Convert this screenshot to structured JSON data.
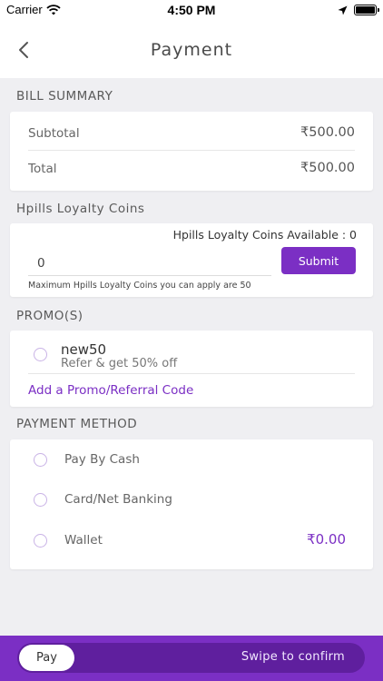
{
  "status_bar": {
    "carrier": "Carrier",
    "time": "4:50 PM"
  },
  "header": {
    "title": "Payment"
  },
  "bill_summary": {
    "heading": "BILL SUMMARY",
    "rows": [
      {
        "label": "Subtotal",
        "value": "₹500.00"
      },
      {
        "label": "Total",
        "value": "₹500.00"
      }
    ]
  },
  "loyalty": {
    "heading": "Hpills Loyalty Coins",
    "available_text": "Hpills Loyalty Coins Available : 0",
    "input_value": "0",
    "submit_label": "Submit",
    "note": "Maximum Hpills Loyalty Coins you can apply are 50"
  },
  "promos": {
    "heading": "PROMO(S)",
    "items": [
      {
        "code": "new50",
        "description": "Refer & get 50% off"
      }
    ],
    "add_link": "Add a Promo/Referral Code"
  },
  "payment_method": {
    "heading": "PAYMENT METHOD",
    "options": [
      {
        "label": "Pay By Cash",
        "amount": ""
      },
      {
        "label": "Card/Net Banking",
        "amount": ""
      },
      {
        "label": "Wallet",
        "amount": "₹0.00"
      }
    ]
  },
  "swipe": {
    "knob_label": "Pay",
    "hint": "Swipe to confirm"
  },
  "colors": {
    "accent": "#7b2fc4",
    "background": "#efeff2",
    "bottom_bar": "#7b2fc4"
  },
  "icons": [
    "wifi-icon",
    "location-arrow-icon",
    "battery-icon",
    "back-chevron-icon"
  ]
}
